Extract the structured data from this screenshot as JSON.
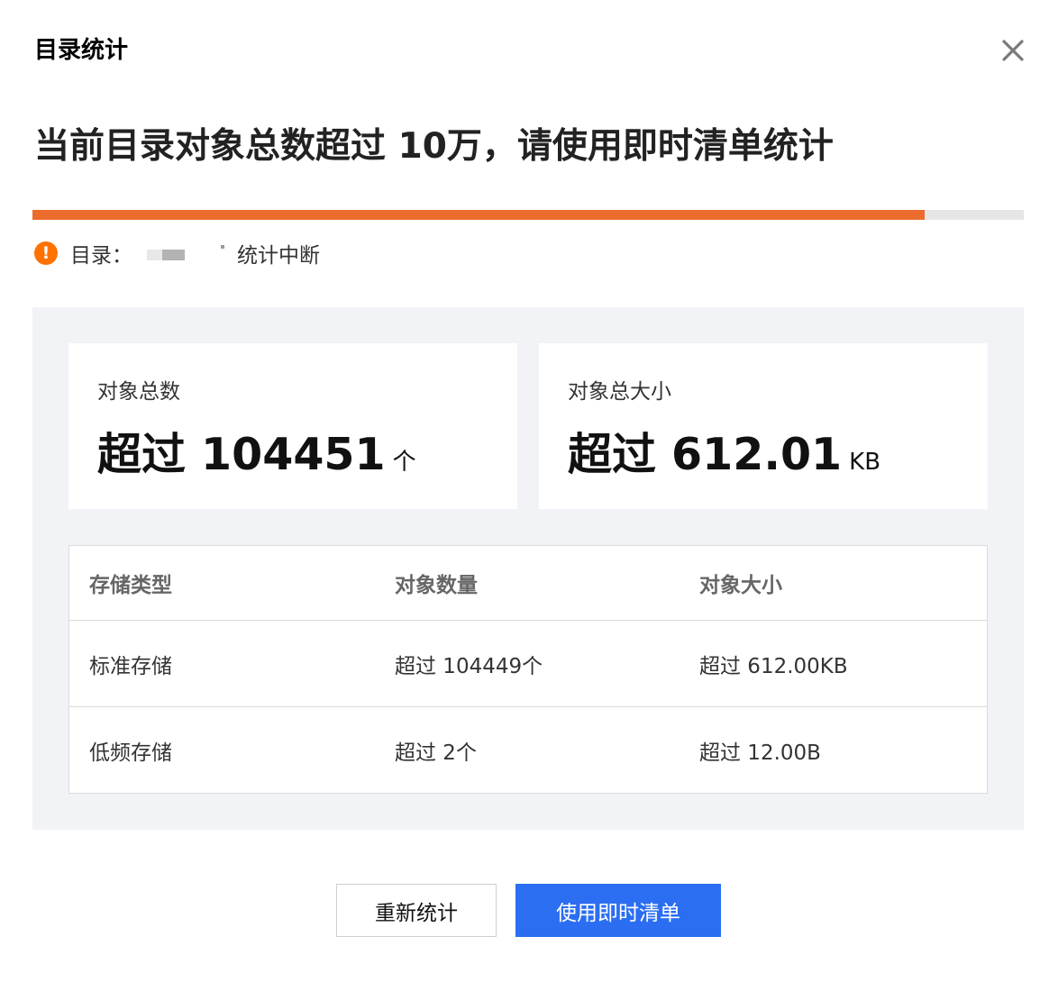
{
  "dialog": {
    "title": "目录统计",
    "headline": "当前目录对象总数超过 10万，请使用即时清单统计",
    "progress_fraction": 0.9,
    "status": {
      "prefix": "目录：",
      "suffix": "统计中断"
    }
  },
  "summary": {
    "count_card": {
      "label": "对象总数",
      "value": "超过 104451",
      "unit": "个"
    },
    "size_card": {
      "label": "对象总大小",
      "value": "超过 612.01",
      "unit": "KB"
    }
  },
  "table": {
    "headers": [
      "存储类型",
      "对象数量",
      "对象大小"
    ],
    "rows": [
      [
        "标准存储",
        "超过 104449个",
        "超过 612.00KB"
      ],
      [
        "低频存储",
        "超过 2个",
        "超过 12.00B"
      ]
    ]
  },
  "buttons": {
    "recount": "重新统计",
    "use_inventory": "使用即时清单"
  },
  "colors": {
    "progress_fill": "#ec6c2d",
    "progress_track": "#e6e6e6",
    "warning": "#ff7200",
    "primary": "#2b6ef2",
    "panel_bg": "#f2f3f7"
  },
  "icons": {
    "close": "close-icon",
    "warning": "exclamation-circle-icon"
  }
}
